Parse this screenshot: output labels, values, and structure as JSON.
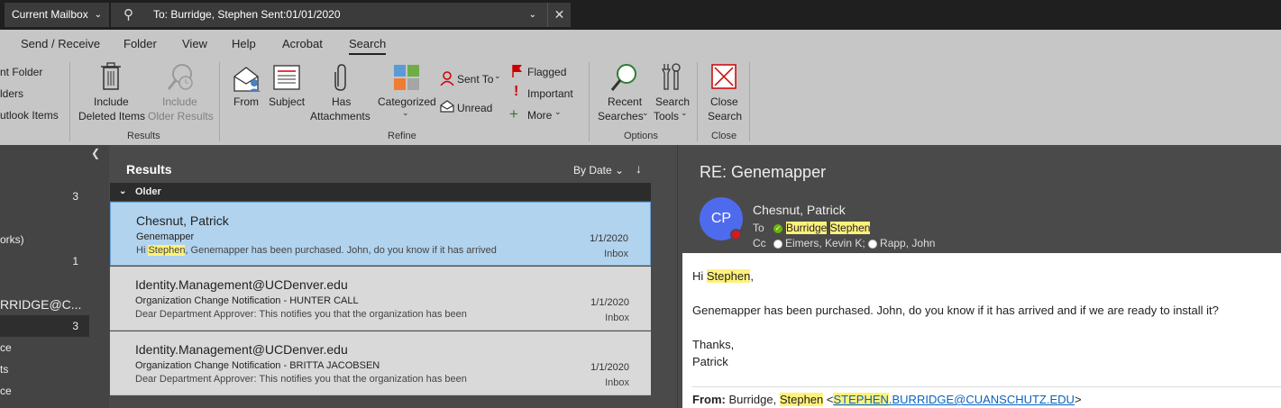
{
  "topbar": {
    "scope": "Current Mailbox",
    "query": "To: Burridge, Stephen Sent:01/01/2020"
  },
  "tabs": [
    "Send / Receive",
    "Folder",
    "View",
    "Help",
    "Acrobat",
    "Search"
  ],
  "ribbon": {
    "scope_items": [
      "nt Folder",
      "lders",
      "utlook Items"
    ],
    "results": {
      "include_deleted": [
        "Include",
        "Deleted Items"
      ],
      "include_older": [
        "Include",
        "Older Results"
      ],
      "label": "Results"
    },
    "refine": {
      "from": "From",
      "subject": "Subject",
      "has_attachments": [
        "Has",
        "Attachments"
      ],
      "categorized": "Categorized",
      "sent_to": "Sent To",
      "unread": "Unread",
      "flagged": "Flagged",
      "important": "Important",
      "more": "More",
      "label": "Refine"
    },
    "options": {
      "recent_searches": [
        "Recent",
        "Searches"
      ],
      "search_tools": [
        "Search",
        "Tools"
      ],
      "label": "Options"
    },
    "close": {
      "close_search": [
        "Close",
        "Search"
      ],
      "label": "Close"
    }
  },
  "folders": [
    {
      "label": "",
      "count": "3"
    },
    {
      "label": "orks)",
      "count": ""
    },
    {
      "label": "",
      "count": "1"
    },
    {
      "label": "RRIDGE@C...",
      "count": ""
    },
    {
      "label": "",
      "count": "3"
    },
    {
      "label": "ce",
      "count": ""
    },
    {
      "label": "ts",
      "count": ""
    },
    {
      "label": "ce",
      "count": ""
    }
  ],
  "results": {
    "title": "Results",
    "sort": "By Date",
    "group": "Older",
    "messages": [
      {
        "from": "Chesnut, Patrick",
        "subject": "Genemapper",
        "preview_pre": "Hi ",
        "preview_hl": "Stephen",
        "preview_post": ",  Genemapper has been purchased.  John, do you know if it has arrived",
        "date": "1/1/2020",
        "folder": "Inbox"
      },
      {
        "from": "Identity.Management@UCDenver.edu",
        "subject": "Organization Change Notification - HUNTER CALL",
        "preview_pre": "Dear Department Approver:  This notifies you that the organization has been",
        "preview_hl": "",
        "preview_post": "",
        "date": "1/1/2020",
        "folder": "Inbox"
      },
      {
        "from": "Identity.Management@UCDenver.edu",
        "subject": "Organization Change Notification - BRITTA JACOBSEN",
        "preview_pre": "Dear Department Approver:  This notifies you that the organization has been",
        "preview_hl": "",
        "preview_post": "",
        "date": "1/1/2020",
        "folder": "Inbox"
      }
    ]
  },
  "reading": {
    "subject": "RE: Genemapper",
    "initials": "CP",
    "sender": "Chesnut, Patrick",
    "to_label": "To",
    "to_a": "Burridge",
    "to_b": "Stephen",
    "cc_label": "Cc",
    "cc_a": "Eimers, Kevin K;",
    "cc_b": "Rapp, John",
    "greeting_pre": "Hi ",
    "greeting_hl": "Stephen",
    "greeting_post": ",",
    "line1": "Genemapper has been purchased.  John, do you know if it has arrived and if we are ready to install it?",
    "thanks": "Thanks,",
    "signoff": "Patrick",
    "from_label": "From:",
    "from_name_pre": " Burridge, ",
    "from_name_hl": "Stephen",
    "from_email_hl": "STEPHEN",
    "from_email_rest": ".BURRIDGE@CUANSCHUTZ.EDU"
  }
}
